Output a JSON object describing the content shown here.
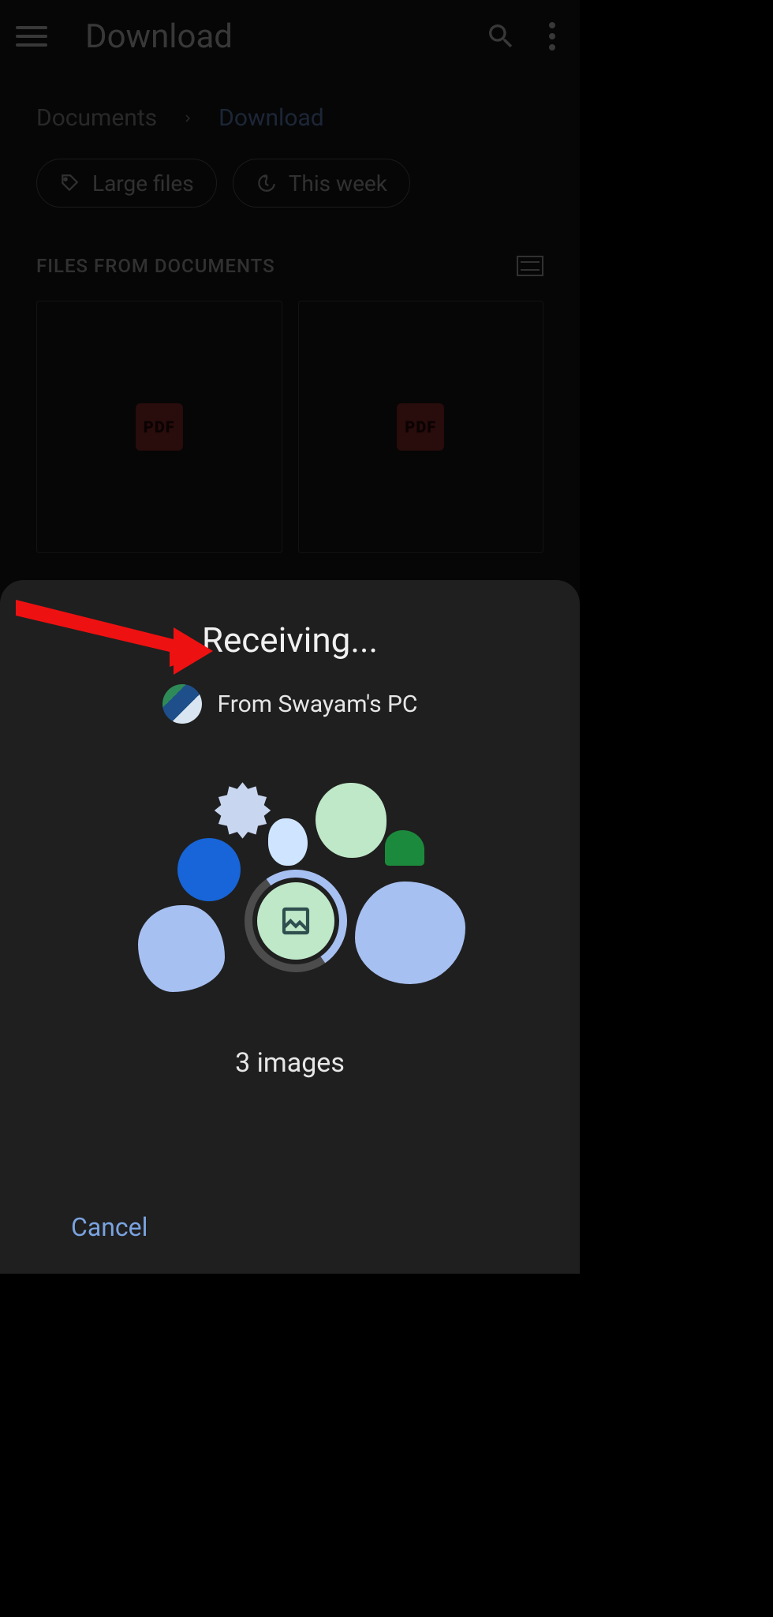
{
  "appbar": {
    "title": "Download"
  },
  "breadcrumbs": {
    "root": "Documents",
    "current": "Download"
  },
  "chips": {
    "large_files": "Large files",
    "this_week": "This week"
  },
  "section": {
    "header": "FILES FROM DOCUMENTS",
    "pdf_label": "PDF"
  },
  "sheet": {
    "title": "Receiving...",
    "from_label": "From Swayam's PC",
    "count_label": "3 images",
    "cancel": "Cancel"
  }
}
